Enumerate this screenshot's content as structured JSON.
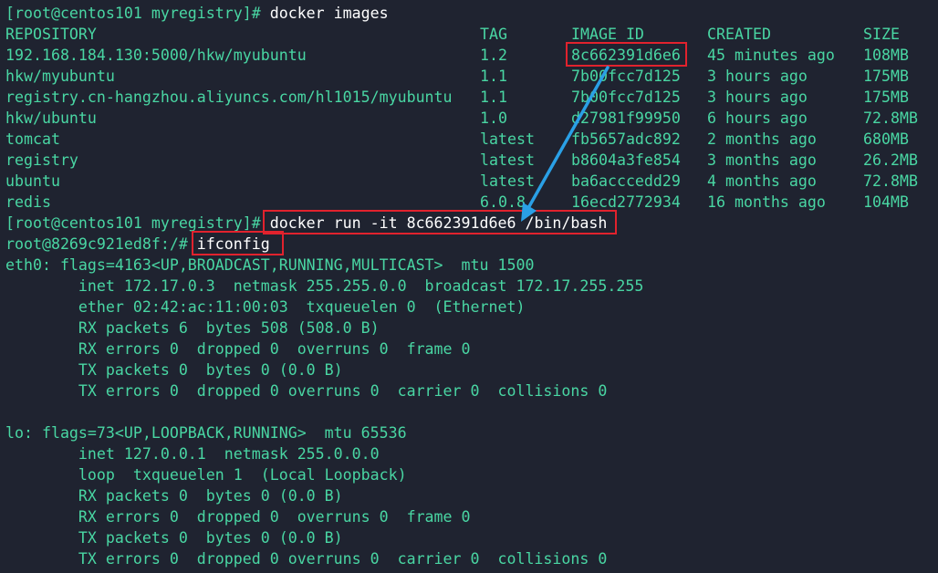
{
  "terminal": {
    "prompt1": "[root@centos101 myregistry]#",
    "cmd1": " docker images",
    "headers": [
      "REPOSITORY",
      "TAG",
      "IMAGE ID",
      "CREATED",
      "SIZE"
    ],
    "rows": [
      [
        "192.168.184.130:5000/hkw/myubuntu",
        "1.2",
        "8c662391d6e6",
        "45 minutes ago",
        "108MB"
      ],
      [
        "hkw/myubuntu",
        "1.1",
        "7b00fcc7d125",
        "3 hours ago",
        "175MB"
      ],
      [
        "registry.cn-hangzhou.aliyuncs.com/hl1015/myubuntu",
        "1.1",
        "7b00fcc7d125",
        "3 hours ago",
        "175MB"
      ],
      [
        "hkw/ubuntu",
        "1.0",
        "d27981f99950",
        "6 hours ago",
        "72.8MB"
      ],
      [
        "tomcat",
        "latest",
        "fb5657adc892",
        "2 months ago",
        "680MB"
      ],
      [
        "registry",
        "latest",
        "b8604a3fe854",
        "3 months ago",
        "26.2MB"
      ],
      [
        "ubuntu",
        "latest",
        "ba6acccedd29",
        "4 months ago",
        "72.8MB"
      ],
      [
        "redis",
        "6.0.8",
        "16ecd2772934",
        "16 months ago",
        "104MB"
      ]
    ],
    "prompt2": "[root@centos101 myregistry]#",
    "cmd2": " docker run -it 8c662391d6e6 /bin/bash",
    "prompt3": "root@8269c921ed8f:/#",
    "cmd3": " ifconfig",
    "eth0": [
      "eth0: flags=4163<UP,BROADCAST,RUNNING,MULTICAST>  mtu 1500",
      "        inet 172.17.0.3  netmask 255.255.0.0  broadcast 172.17.255.255",
      "        ether 02:42:ac:11:00:03  txqueuelen 0  (Ethernet)",
      "        RX packets 6  bytes 508 (508.0 B)",
      "        RX errors 0  dropped 0  overruns 0  frame 0",
      "        TX packets 0  bytes 0 (0.0 B)",
      "        TX errors 0  dropped 0 overruns 0  carrier 0  collisions 0"
    ],
    "lo": [
      "lo: flags=73<UP,LOOPBACK,RUNNING>  mtu 65536",
      "        inet 127.0.0.1  netmask 255.0.0.0",
      "        loop  txqueuelen 1  (Local Loopback)",
      "        RX packets 0  bytes 0 (0.0 B)",
      "        RX errors 0  dropped 0  overruns 0  frame 0",
      "        TX packets 0  bytes 0 (0.0 B)",
      "        TX errors 0  dropped 0 overruns 0  carrier 0  collisions 0"
    ]
  },
  "colors": {
    "background": "#1f2330",
    "text": "#49d6a3",
    "command": "#ffffff",
    "highlight": "#e1222d",
    "arrow": "#2aa0e6"
  }
}
